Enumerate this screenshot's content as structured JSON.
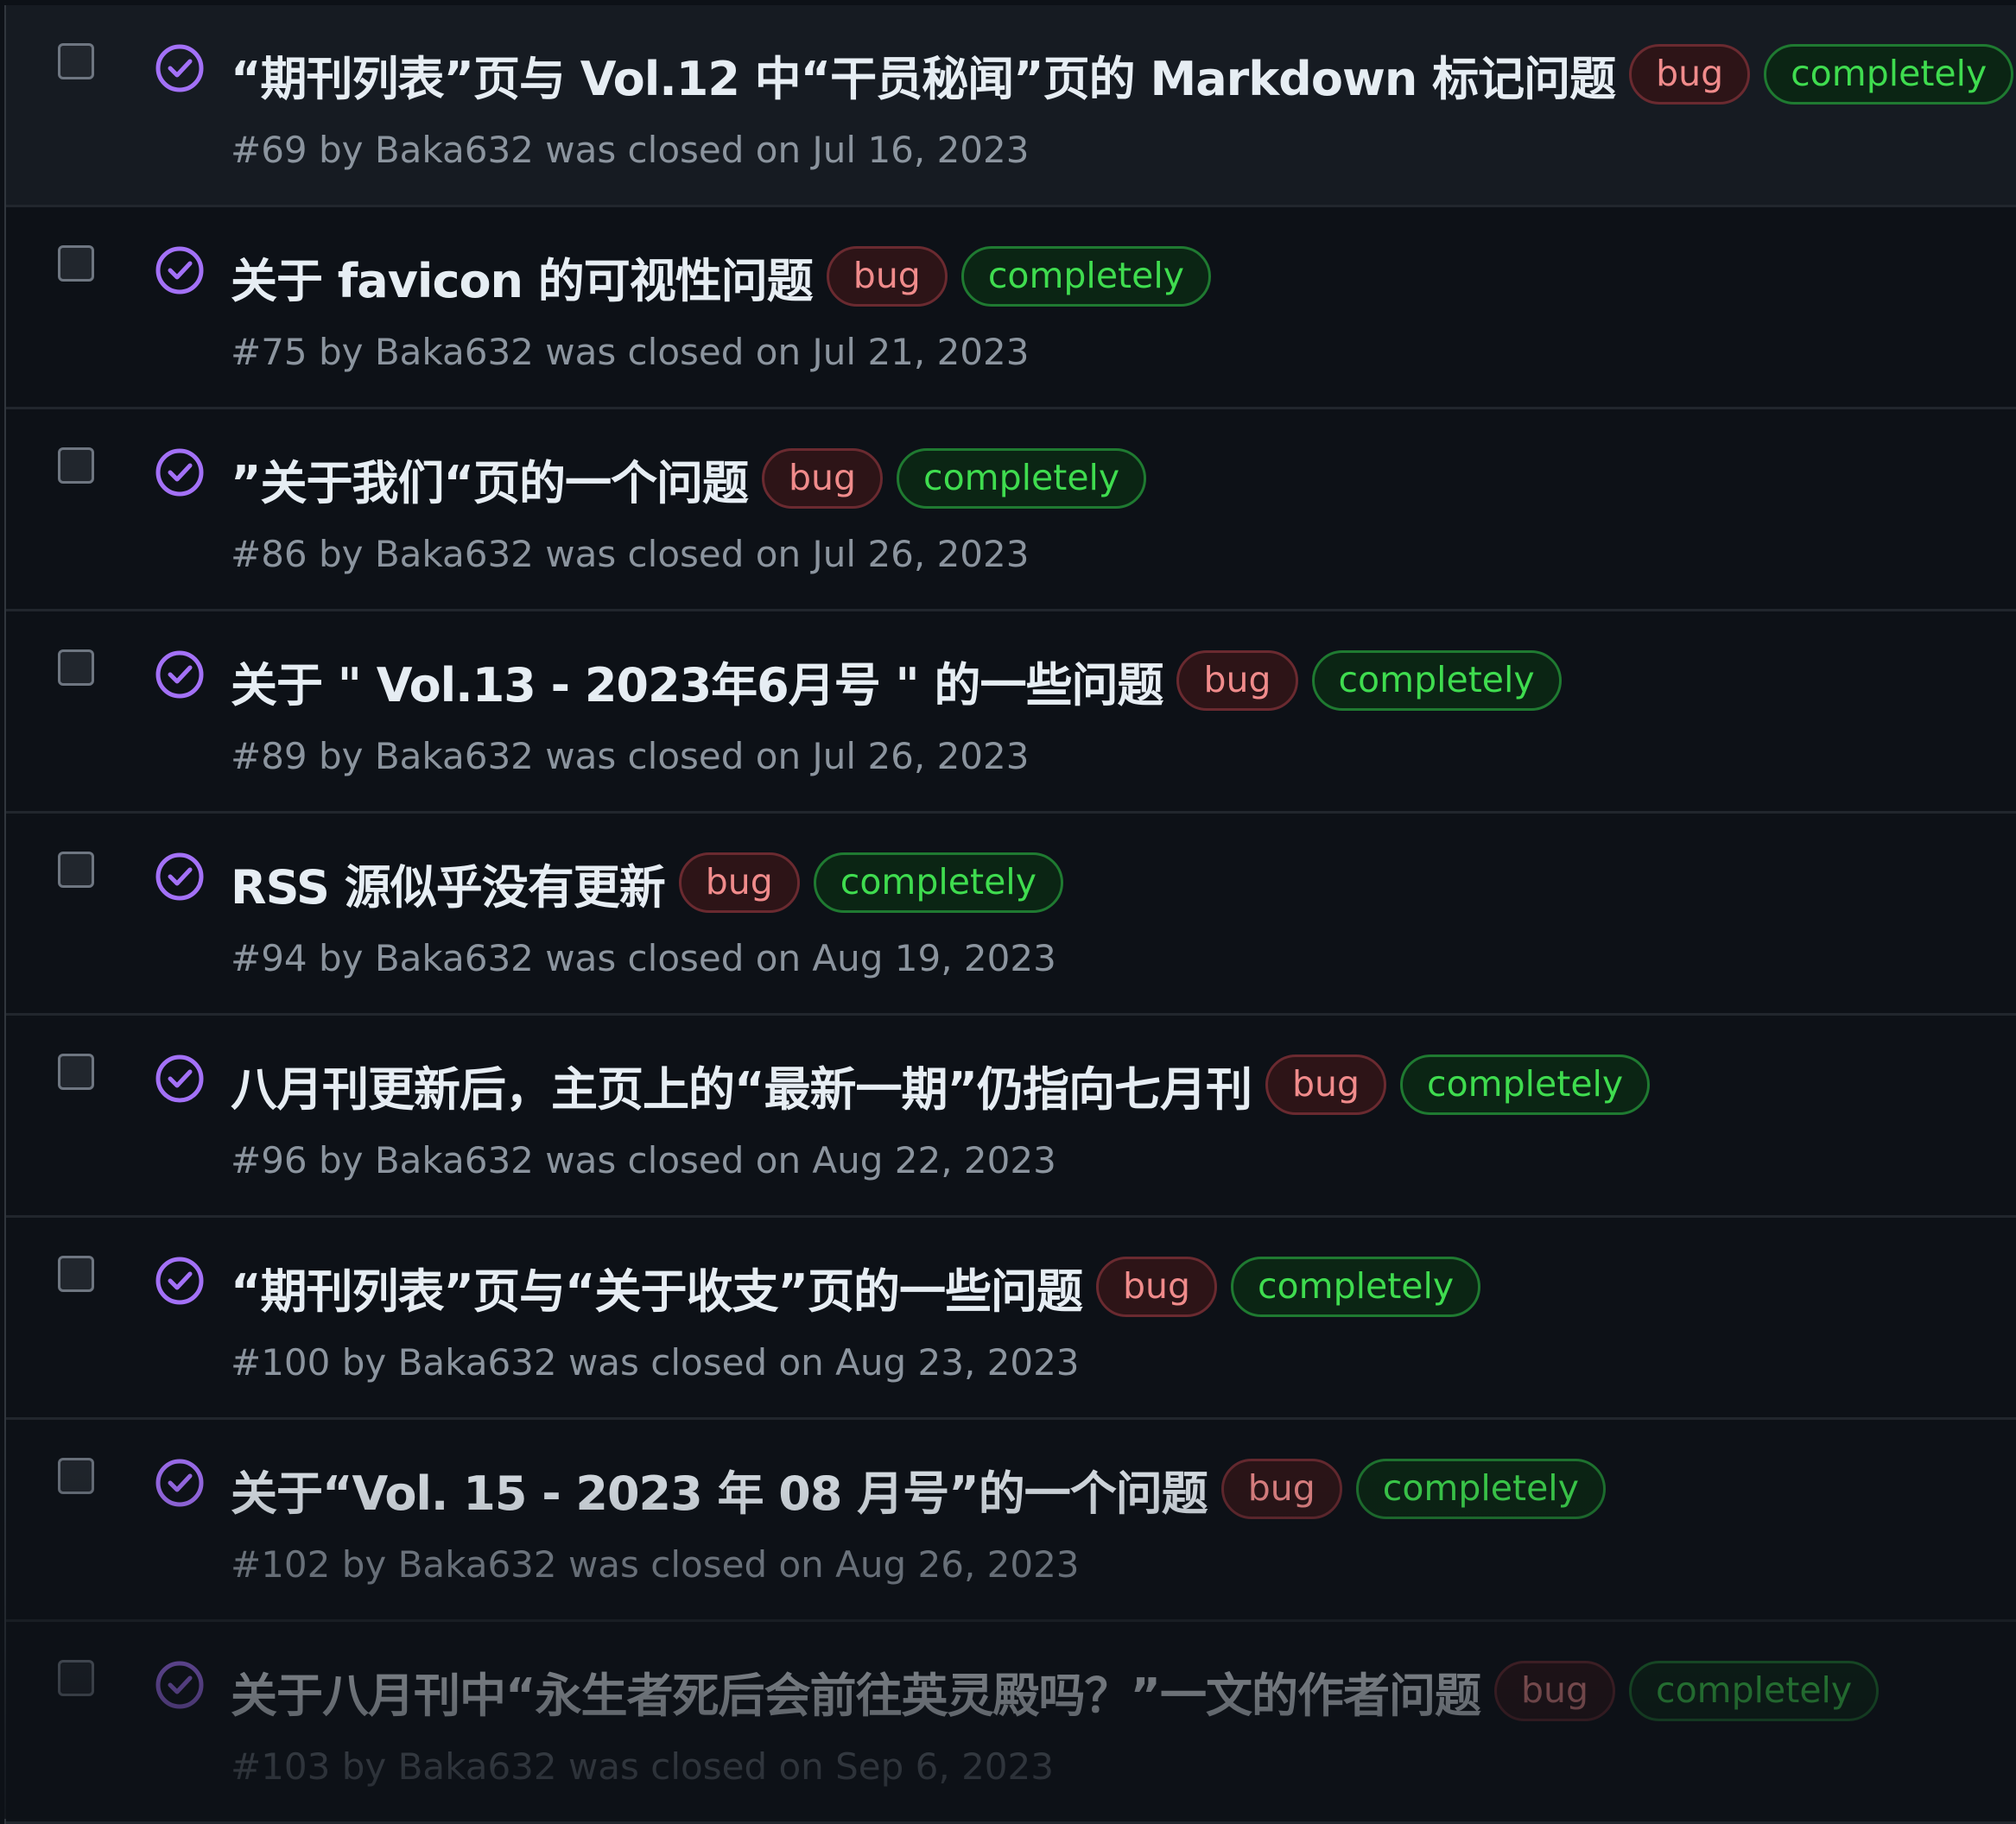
{
  "issues": [
    {
      "title": "“期刊列表”页与 Vol.12 中“干员秘闻”页的 Markdown 标记问题",
      "label_bug": "bug",
      "label_status": "completely",
      "meta": "#69 by Baka632 was closed on Jul 16, 2023"
    },
    {
      "title": "关于 favicon 的可视性问题",
      "label_bug": "bug",
      "label_status": "completely",
      "meta": "#75 by Baka632 was closed on Jul 21, 2023"
    },
    {
      "title": "”关于我们“页的一个问题",
      "label_bug": "bug",
      "label_status": "completely",
      "meta": "#86 by Baka632 was closed on Jul 26, 2023"
    },
    {
      "title": "关于 \" Vol.13 - 2023年6月号 \" 的一些问题",
      "label_bug": "bug",
      "label_status": "completely",
      "meta": "#89 by Baka632 was closed on Jul 26, 2023"
    },
    {
      "title": "RSS 源似乎没有更新",
      "label_bug": "bug",
      "label_status": "completely",
      "meta": "#94 by Baka632 was closed on Aug 19, 2023"
    },
    {
      "title": "八月刊更新后，主页上的“最新一期”仍指向七月刊",
      "label_bug": "bug",
      "label_status": "completely",
      "meta": "#96 by Baka632 was closed on Aug 22, 2023"
    },
    {
      "title": "“期刊列表”页与“关于收支”页的一些问题",
      "label_bug": "bug",
      "label_status": "completely",
      "meta": "#100 by Baka632 was closed on Aug 23, 2023"
    },
    {
      "title": "关于“Vol. 15 - 2023 年 08 月号”的一个问题",
      "label_bug": "bug",
      "label_status": "completely",
      "meta": "#102 by Baka632 was closed on Aug 26, 2023"
    },
    {
      "title": "关于八月刊中“永生者死后会前往英灵殿吗？”一文的作者问题",
      "label_bug": "bug",
      "label_status": "completely",
      "meta": "#103 by Baka632 was closed on Sep 6, 2023"
    }
  ],
  "colors": {
    "background": "#0d1117",
    "title": "#e6edf3",
    "meta": "#8b949e",
    "closed_icon": "#a371f7",
    "bug_label_text": "#f08b8b",
    "completely_label_text": "#3fdc4f"
  },
  "icons": {
    "status": "check-circle-icon",
    "checkbox": "checkbox"
  }
}
